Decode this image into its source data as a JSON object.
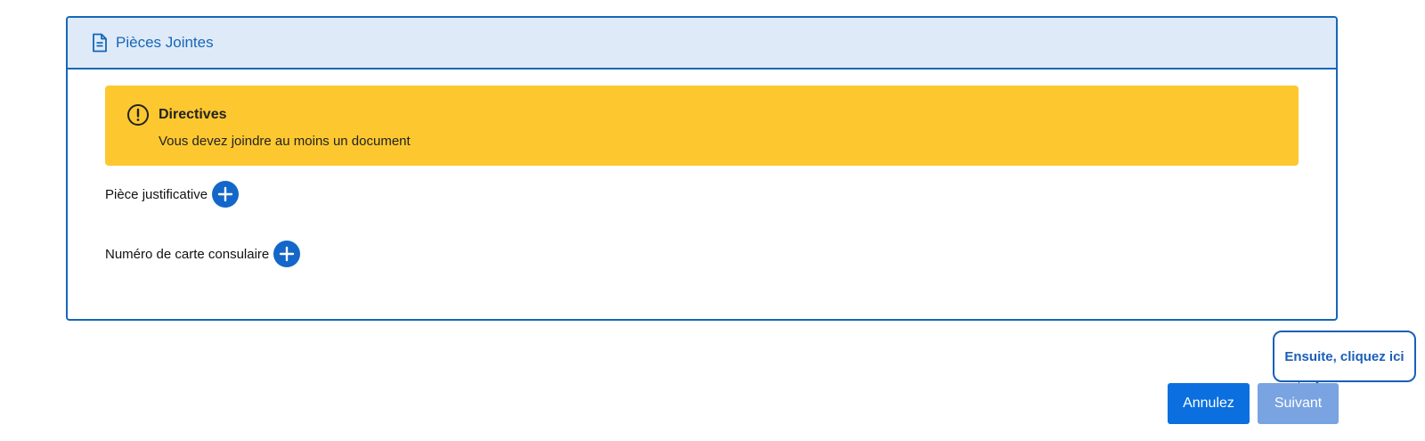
{
  "panel": {
    "title": "Pièces Jointes",
    "title_icon": "document-icon"
  },
  "alert": {
    "icon": "exclamation-circle-icon",
    "title": "Directives",
    "text": "Vous devez joindre au moins un document"
  },
  "attachments": [
    {
      "label": "Pièce justificative",
      "action_icon": "plus-circle-icon"
    },
    {
      "label": "Numéro de carte consulaire",
      "action_icon": "plus-circle-icon"
    }
  ],
  "actions": {
    "cancel_label": "Annulez",
    "next_label": "Suivant"
  },
  "tooltip": {
    "text": "Ensuite, cliquez ici"
  },
  "colors": {
    "brand_blue": "#1467b8",
    "header_bg": "#dfeaf8",
    "alert_bg": "#fdc82f",
    "cancel_bg": "#0b6fdf",
    "next_bg_disabled": "#79a3e1"
  }
}
